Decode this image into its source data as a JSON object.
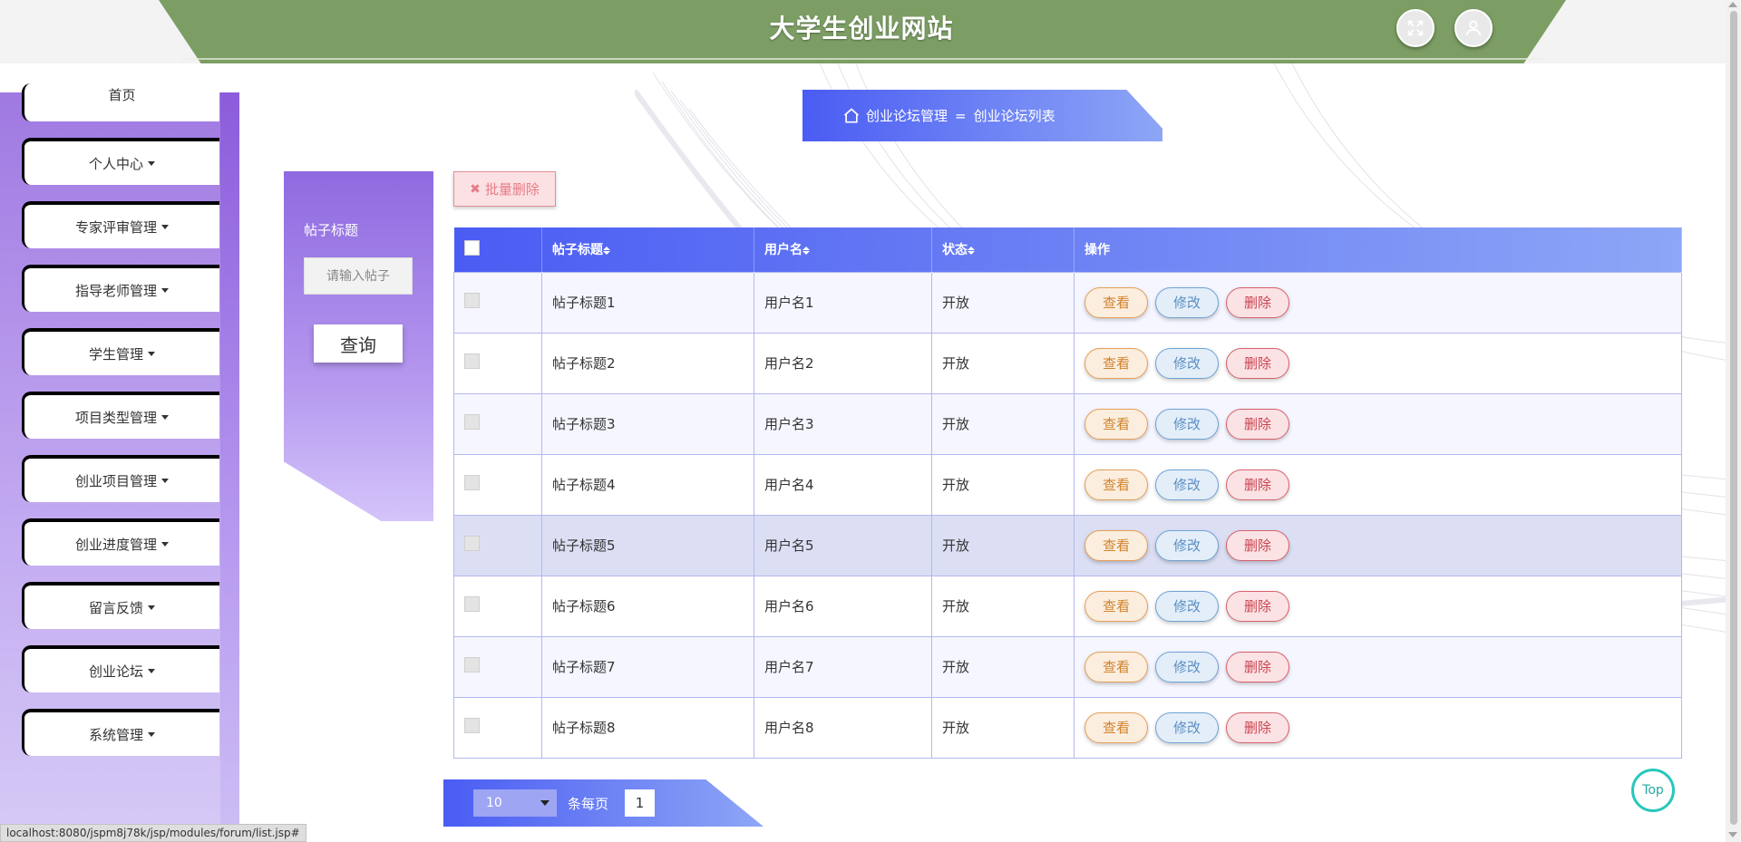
{
  "header": {
    "title": "大学生创业网站"
  },
  "icons": {
    "fullscreen": "fullscreen-icon",
    "user": "user-icon",
    "home": "home-icon"
  },
  "sidebar": {
    "items": [
      {
        "label": "首页",
        "has_caret": false
      },
      {
        "label": "个人中心",
        "has_caret": true
      },
      {
        "label": "专家评审管理",
        "has_caret": true
      },
      {
        "label": "指导老师管理",
        "has_caret": true
      },
      {
        "label": "学生管理",
        "has_caret": true
      },
      {
        "label": "项目类型管理",
        "has_caret": true
      },
      {
        "label": "创业项目管理",
        "has_caret": true
      },
      {
        "label": "创业进度管理",
        "has_caret": true
      },
      {
        "label": "留言反馈",
        "has_caret": true
      },
      {
        "label": "创业论坛",
        "has_caret": true
      },
      {
        "label": "系统管理",
        "has_caret": true
      }
    ]
  },
  "breadcrumb": {
    "section": "创业论坛管理",
    "separator": "=",
    "page": "创业论坛列表"
  },
  "search": {
    "label": "帖子标题",
    "placeholder": "请输入帖子",
    "button": "查询"
  },
  "toolbar": {
    "batch_delete": "批量删除"
  },
  "table": {
    "columns": [
      "帖子标题",
      "用户名",
      "状态",
      "操作"
    ],
    "actions": {
      "view": "查看",
      "edit": "修改",
      "delete": "删除"
    },
    "rows": [
      {
        "title": "帖子标题1",
        "user": "用户名1",
        "status": "开放"
      },
      {
        "title": "帖子标题2",
        "user": "用户名2",
        "status": "开放"
      },
      {
        "title": "帖子标题3",
        "user": "用户名3",
        "status": "开放"
      },
      {
        "title": "帖子标题4",
        "user": "用户名4",
        "status": "开放"
      },
      {
        "title": "帖子标题5",
        "user": "用户名5",
        "status": "开放"
      },
      {
        "title": "帖子标题6",
        "user": "用户名6",
        "status": "开放"
      },
      {
        "title": "帖子标题7",
        "user": "用户名7",
        "status": "开放"
      },
      {
        "title": "帖子标题8",
        "user": "用户名8",
        "status": "开放"
      }
    ],
    "highlighted_row": 5
  },
  "pagination": {
    "page_size": "10",
    "per_page_label": "条每页",
    "current_page": "1"
  },
  "top_button": "Top",
  "status_url": "localhost:8080/jspm8j78k/jsp/modules/forum/list.jsp#",
  "colors": {
    "header": "#7c9e64",
    "accent": "#4a5cf3",
    "sidebar": "#8b5cdb"
  }
}
